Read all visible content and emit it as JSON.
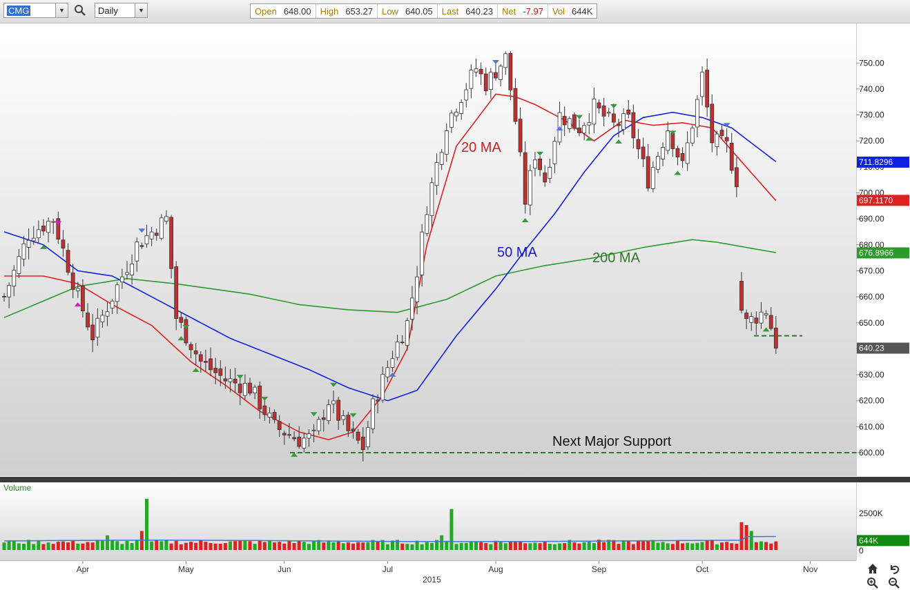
{
  "toolbar": {
    "symbol": "CMG",
    "interval": "Daily",
    "quote": [
      {
        "label": "Open",
        "value": "648.00"
      },
      {
        "label": "High",
        "value": "653.27"
      },
      {
        "label": "Low",
        "value": "640.05"
      },
      {
        "label": "Last",
        "value": "640.23"
      },
      {
        "label": "Net",
        "value": "-7.97"
      },
      {
        "label": "Vol",
        "value": "644K"
      }
    ]
  },
  "colors": {
    "up_candle": "#ffffff",
    "down_candle": "#c03030",
    "ma20": "#e02020",
    "ma50": "#1020e0",
    "ma200": "#2a9a2a",
    "support_line": "#2a7a2a",
    "volume_up": "#22aa22",
    "volume_down": "#dd2222",
    "volume_avg": "#3a7ad0"
  },
  "chart_data": {
    "type": "candlestick",
    "symbol": "CMG",
    "interval": "Daily",
    "year": "2015",
    "x_ticks": [
      "Apr",
      "May",
      "Jun",
      "Jul",
      "Aug",
      "Sep",
      "Oct",
      "Nov"
    ],
    "y_ticks": [
      "600.00",
      "610.00",
      "620.00",
      "630.00",
      "640.00",
      "650.00",
      "660.00",
      "670.00",
      "680.00",
      "690.00",
      "700.00",
      "710.00",
      "720.00",
      "730.00",
      "740.00",
      "750.00"
    ],
    "ylim": [
      590,
      762
    ],
    "price_labels": [
      {
        "name": "50 MA",
        "value": "711.8296",
        "color": "#1020e0"
      },
      {
        "name": "20 MA",
        "value": "697.1170",
        "color": "#e02020"
      },
      {
        "name": "200 MA",
        "value": "676.8966",
        "color": "#2a9a2a"
      },
      {
        "name": "Last",
        "value": "640.23",
        "color": "#555555"
      }
    ],
    "annotations": [
      {
        "text": "20 MA",
        "color": "#cc2222"
      },
      {
        "text": "50 MA",
        "color": "#1a1ad0"
      },
      {
        "text": "200 MA",
        "color": "#2a7a2a"
      },
      {
        "text": "Next Major Support",
        "color": "#111111"
      }
    ],
    "support_level": 600,
    "recent_support_level": 645,
    "price_anchors": [
      [
        0,
        660
      ],
      [
        5,
        684
      ],
      [
        10,
        690
      ],
      [
        15,
        660
      ],
      [
        18,
        645
      ],
      [
        22,
        660
      ],
      [
        27,
        680
      ],
      [
        33,
        690
      ],
      [
        35,
        652
      ],
      [
        40,
        635
      ],
      [
        45,
        628
      ],
      [
        50,
        625
      ],
      [
        55,
        610
      ],
      [
        60,
        605
      ],
      [
        63,
        606
      ],
      [
        66,
        620
      ],
      [
        70,
        608
      ],
      [
        73,
        602
      ],
      [
        75,
        618
      ],
      [
        79,
        638
      ],
      [
        82,
        650
      ],
      [
        84,
        670
      ],
      [
        86,
        695
      ],
      [
        90,
        727
      ],
      [
        96,
        748
      ],
      [
        98,
        742
      ],
      [
        102,
        752
      ],
      [
        104,
        728
      ],
      [
        106,
        697
      ],
      [
        108,
        715
      ],
      [
        110,
        705
      ],
      [
        113,
        730
      ],
      [
        117,
        725
      ],
      [
        120,
        733
      ],
      [
        124,
        726
      ],
      [
        127,
        728
      ],
      [
        131,
        705
      ],
      [
        135,
        725
      ],
      [
        138,
        710
      ],
      [
        141,
        735
      ],
      [
        142,
        745
      ],
      [
        144,
        720
      ],
      [
        147,
        718
      ],
      [
        149,
        705
      ],
      [
        150,
        655
      ],
      [
        151,
        650
      ],
      [
        155,
        655
      ],
      [
        157,
        642
      ]
    ],
    "ma20_anchors": [
      [
        0,
        668
      ],
      [
        8,
        668
      ],
      [
        15,
        665
      ],
      [
        22,
        657
      ],
      [
        30,
        649
      ],
      [
        38,
        635
      ],
      [
        45,
        626
      ],
      [
        52,
        616
      ],
      [
        60,
        608
      ],
      [
        66,
        605
      ],
      [
        71,
        608
      ],
      [
        77,
        622
      ],
      [
        82,
        640
      ],
      [
        86,
        680
      ],
      [
        92,
        718
      ],
      [
        100,
        738
      ],
      [
        104,
        737
      ],
      [
        108,
        734
      ],
      [
        114,
        728
      ],
      [
        120,
        720
      ],
      [
        126,
        728
      ],
      [
        132,
        726
      ],
      [
        138,
        727
      ],
      [
        144,
        725
      ],
      [
        150,
        712
      ],
      [
        157,
        697
      ]
    ],
    "ma50_anchors": [
      [
        0,
        685
      ],
      [
        8,
        680
      ],
      [
        15,
        670
      ],
      [
        22,
        668
      ],
      [
        30,
        660
      ],
      [
        38,
        652
      ],
      [
        46,
        644
      ],
      [
        54,
        638
      ],
      [
        62,
        632
      ],
      [
        70,
        625
      ],
      [
        78,
        620
      ],
      [
        84,
        624
      ],
      [
        92,
        645
      ],
      [
        100,
        663
      ],
      [
        106,
        678
      ],
      [
        112,
        692
      ],
      [
        118,
        708
      ],
      [
        124,
        722
      ],
      [
        130,
        729
      ],
      [
        136,
        731
      ],
      [
        142,
        729
      ],
      [
        148,
        725
      ],
      [
        157,
        712
      ]
    ],
    "ma200_anchors": [
      [
        0,
        652
      ],
      [
        15,
        664
      ],
      [
        25,
        667
      ],
      [
        35,
        665
      ],
      [
        50,
        661
      ],
      [
        60,
        657
      ],
      [
        70,
        655
      ],
      [
        80,
        654
      ],
      [
        90,
        659
      ],
      [
        100,
        668
      ],
      [
        110,
        672
      ],
      [
        120,
        675
      ],
      [
        130,
        679
      ],
      [
        140,
        682
      ],
      [
        145,
        681
      ],
      [
        157,
        677
      ]
    ],
    "volume": {
      "label": "Volume",
      "y_ticks": [
        "2500K",
        "0"
      ],
      "last_value": "644K",
      "peak_values_K": [
        3500,
        2800,
        1900,
        1700,
        1300
      ]
    }
  }
}
